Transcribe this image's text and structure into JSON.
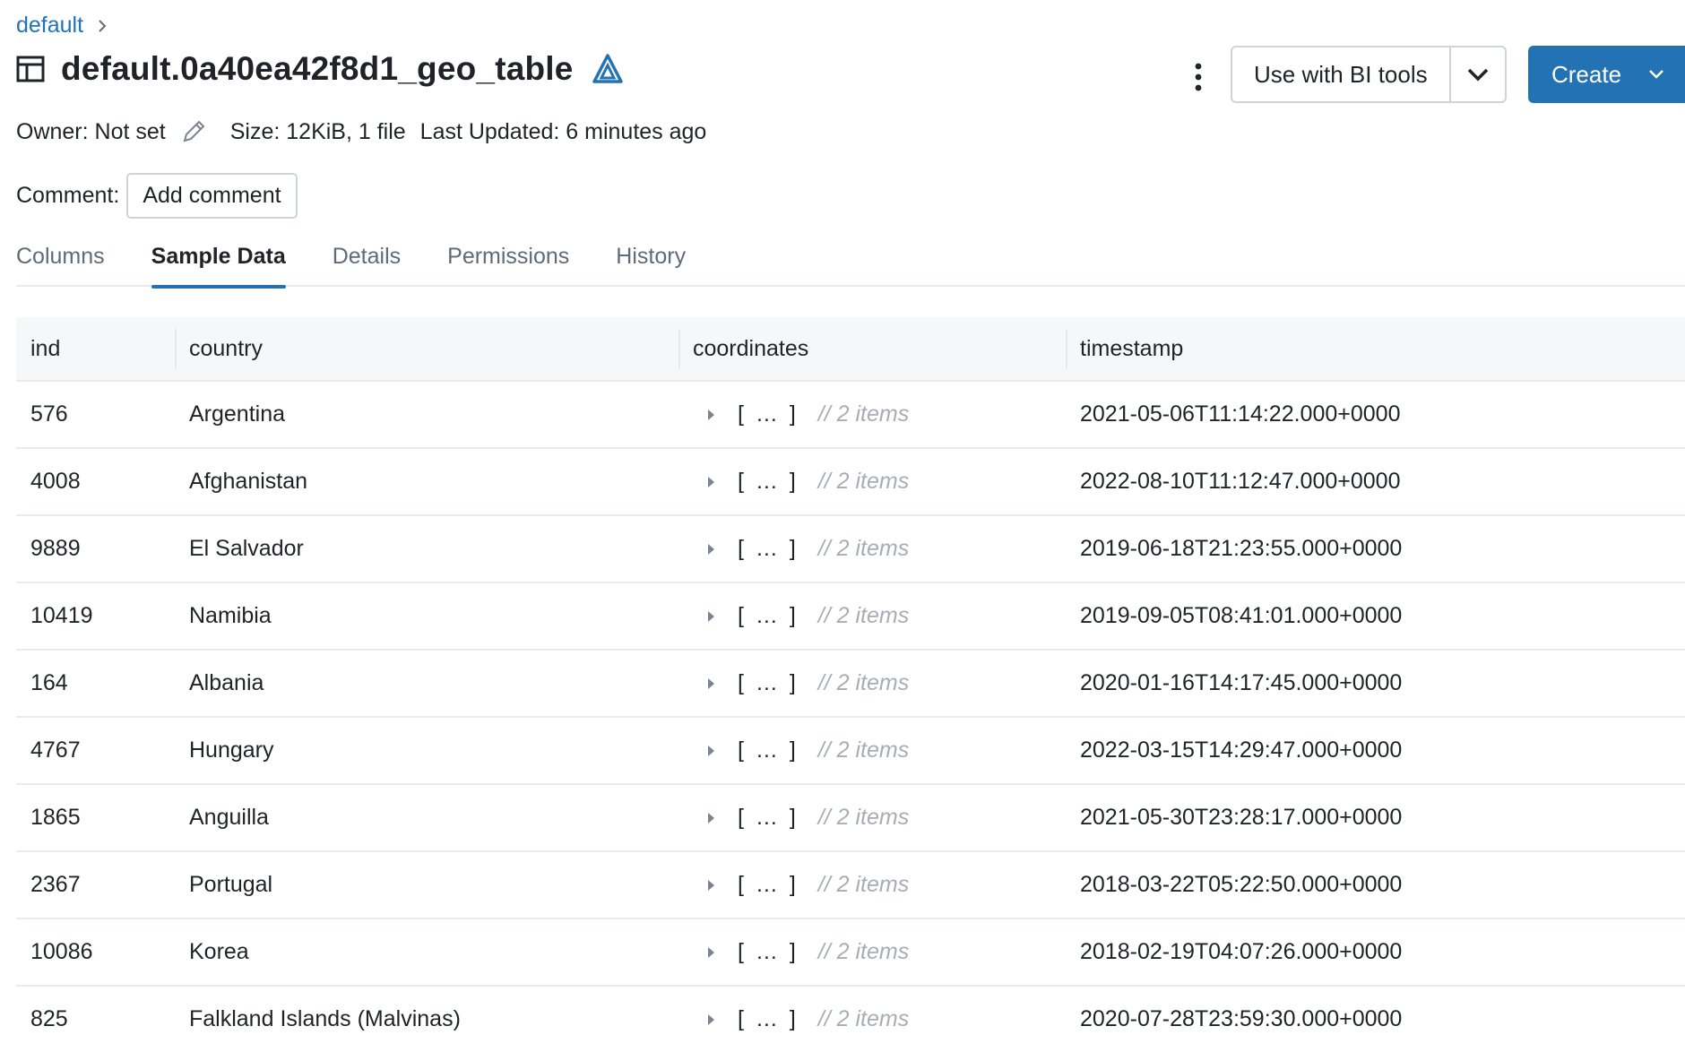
{
  "breadcrumb": {
    "catalog": "default"
  },
  "header": {
    "title": "default.0a40ea42f8d1_geo_table",
    "bi_tools_label": "Use with BI tools",
    "create_label": "Create"
  },
  "meta": {
    "owner": "Owner: Not set",
    "size": "Size: 12KiB, 1 file",
    "updated": "Last Updated: 6 minutes ago"
  },
  "comment": {
    "label": "Comment:",
    "button": "Add comment"
  },
  "tabs": [
    {
      "label": "Columns",
      "active": false
    },
    {
      "label": "Sample Data",
      "active": true
    },
    {
      "label": "Details",
      "active": false
    },
    {
      "label": "Permissions",
      "active": false
    },
    {
      "label": "History",
      "active": false
    }
  ],
  "table": {
    "columns": [
      "ind",
      "country",
      "coordinates",
      "timestamp"
    ],
    "coord_bracket": "[ … ]",
    "coord_items": "// 2 items",
    "rows": [
      {
        "ind": "576",
        "country": "Argentina",
        "timestamp": "2021-05-06T11:14:22.000+0000"
      },
      {
        "ind": "4008",
        "country": "Afghanistan",
        "timestamp": "2022-08-10T11:12:47.000+0000"
      },
      {
        "ind": "9889",
        "country": "El Salvador",
        "timestamp": "2019-06-18T21:23:55.000+0000"
      },
      {
        "ind": "10419",
        "country": "Namibia",
        "timestamp": "2019-09-05T08:41:01.000+0000"
      },
      {
        "ind": "164",
        "country": "Albania",
        "timestamp": "2020-01-16T14:17:45.000+0000"
      },
      {
        "ind": "4767",
        "country": "Hungary",
        "timestamp": "2022-03-15T14:29:47.000+0000"
      },
      {
        "ind": "1865",
        "country": "Anguilla",
        "timestamp": "2021-05-30T23:28:17.000+0000"
      },
      {
        "ind": "2367",
        "country": "Portugal",
        "timestamp": "2018-03-22T05:22:50.000+0000"
      },
      {
        "ind": "10086",
        "country": "Korea",
        "timestamp": "2018-02-19T04:07:26.000+0000"
      },
      {
        "ind": "825",
        "country": "Falkland Islands (Malvinas)",
        "timestamp": "2020-07-28T23:59:30.000+0000"
      }
    ]
  },
  "icons": {
    "table": "table-icon",
    "delta": "delta-icon",
    "kebab": "kebab-menu-icon",
    "pencil": "pencil-icon",
    "expand": "caret-right-icon"
  },
  "colors": {
    "accent": "#2272b4",
    "muted": "#a6adb5",
    "border": "#cfd4d9"
  }
}
